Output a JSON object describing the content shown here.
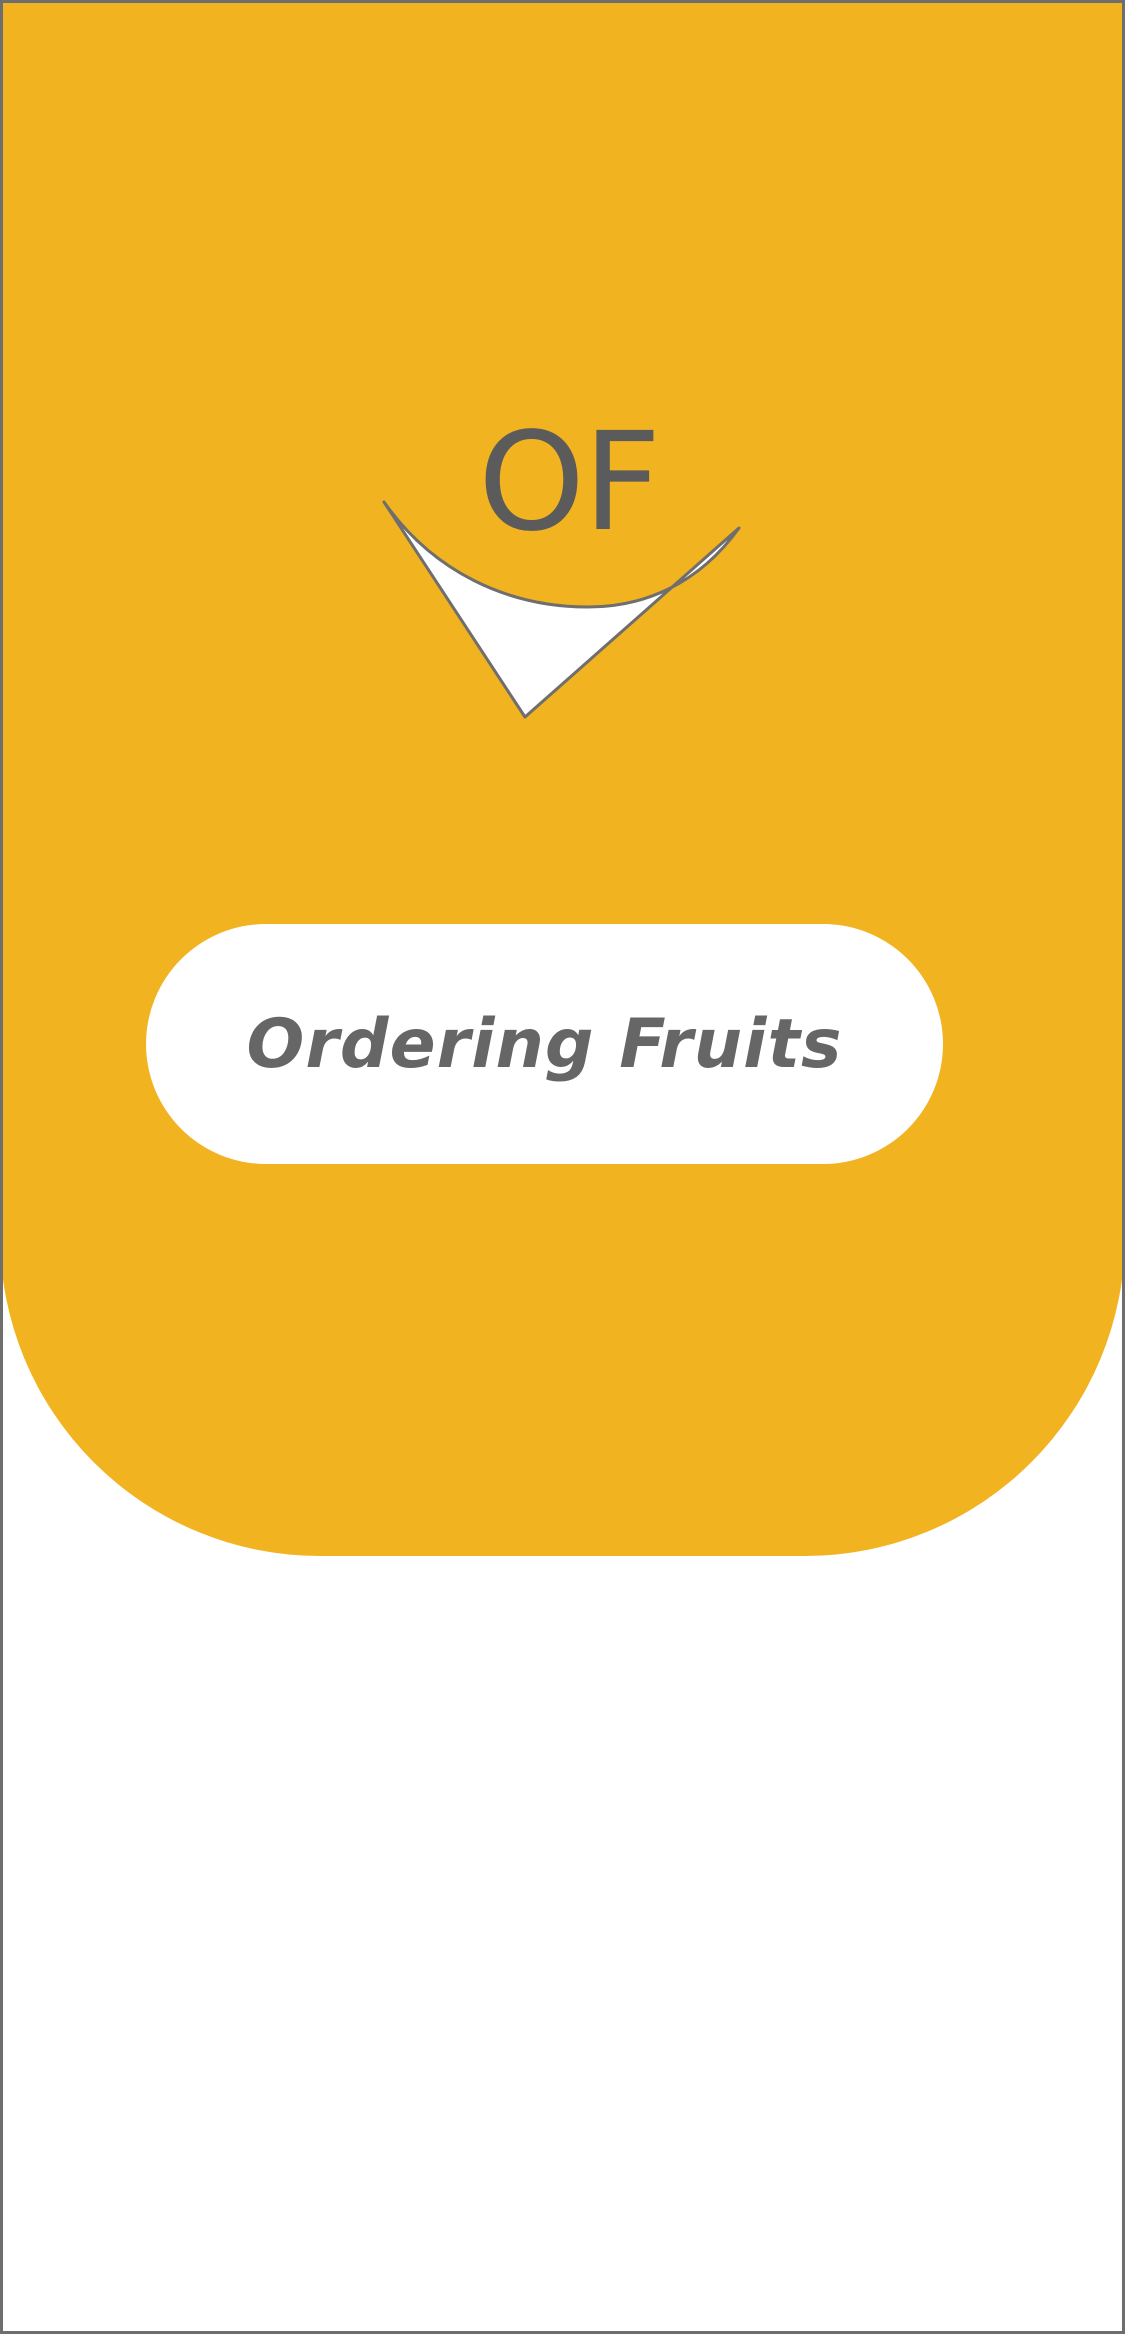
{
  "app": {
    "logo_text": "OF",
    "cta_label": "Ordering Fruits"
  },
  "colors": {
    "hero_background": "#f1b320",
    "logo_text": "#5b5b5b",
    "cta_text": "#666666",
    "frame_border": "#6e6e6e"
  },
  "icons": {
    "logo_mark": "smile-checkmark-icon"
  }
}
